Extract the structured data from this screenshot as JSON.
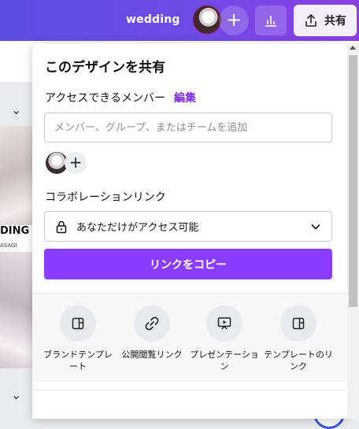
{
  "topbar": {
    "design_title": "wedding",
    "add_collaborator_label": "+",
    "share_label": "共有"
  },
  "editor": {
    "thumb1_text": "DING",
    "thumb1_sub": "ASAGI"
  },
  "share_panel": {
    "title": "このデザインを共有",
    "access_members_label": "アクセスできるメンバー",
    "edit_link": "編集",
    "member_input_placeholder": "メンバー、グループ、またはチームを追加",
    "add_member_label": "+",
    "collab_link_label": "コラボレーションリンク",
    "access_setting_value": "あなただけがアクセス可能",
    "copy_link_button": "リンクをコピー",
    "options": [
      {
        "label": "ブランドテンプレート",
        "icon": "template-layout-icon"
      },
      {
        "label": "公開閲覧リンク",
        "icon": "link-icon"
      },
      {
        "label": "プレゼンテーション",
        "icon": "presentation-icon"
      },
      {
        "label": "テンプレートのリンク",
        "icon": "template-layout-icon"
      }
    ]
  },
  "colors": {
    "accent": "#8b3dff",
    "edit_link": "#7d2ae8",
    "topbar_start": "#5b4ee3",
    "topbar_end": "#8b3fe4"
  }
}
